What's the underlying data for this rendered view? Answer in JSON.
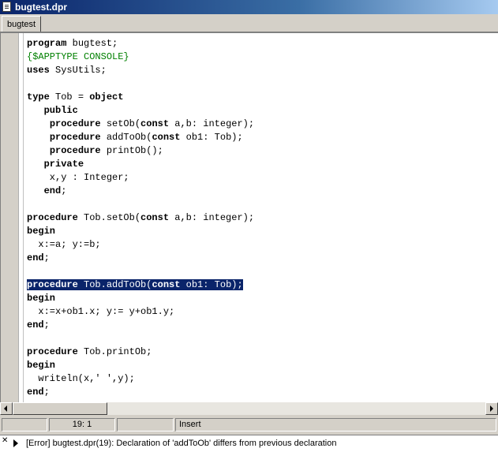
{
  "window": {
    "title": "bugtest.dpr"
  },
  "tabs": [
    {
      "label": "bugtest"
    }
  ],
  "editor": {
    "lines": [
      [
        {
          "t": "program",
          "k": "kw"
        },
        {
          "t": " bugtest;"
        }
      ],
      [
        {
          "t": "{$APPTYPE CONSOLE}",
          "k": "dir"
        }
      ],
      [
        {
          "t": "uses",
          "k": "kw"
        },
        {
          "t": " SysUtils;"
        }
      ],
      [],
      [
        {
          "t": "type",
          "k": "kw"
        },
        {
          "t": " Tob = "
        },
        {
          "t": "object",
          "k": "kw"
        }
      ],
      [
        {
          "t": "   "
        },
        {
          "t": "public",
          "k": "kw"
        }
      ],
      [
        {
          "t": "    "
        },
        {
          "t": "procedure",
          "k": "kw"
        },
        {
          "t": " setOb("
        },
        {
          "t": "const",
          "k": "kw"
        },
        {
          "t": " a,b: integer);"
        }
      ],
      [
        {
          "t": "    "
        },
        {
          "t": "procedure",
          "k": "kw"
        },
        {
          "t": " addToOb("
        },
        {
          "t": "const",
          "k": "kw"
        },
        {
          "t": " ob1: Tob);"
        }
      ],
      [
        {
          "t": "    "
        },
        {
          "t": "procedure",
          "k": "kw"
        },
        {
          "t": " printOb();"
        }
      ],
      [
        {
          "t": "   "
        },
        {
          "t": "private",
          "k": "kw"
        }
      ],
      [
        {
          "t": "    x,y : Integer;"
        }
      ],
      [
        {
          "t": "   "
        },
        {
          "t": "end",
          "k": "kw"
        },
        {
          "t": ";"
        }
      ],
      [],
      [
        {
          "t": "procedure",
          "k": "kw"
        },
        {
          "t": " Tob.setOb("
        },
        {
          "t": "const",
          "k": "kw"
        },
        {
          "t": " a,b: integer);"
        }
      ],
      [
        {
          "t": "begin",
          "k": "kw"
        }
      ],
      [
        {
          "t": "  x:=a; y:=b;"
        }
      ],
      [
        {
          "t": "end",
          "k": "kw"
        },
        {
          "t": ";"
        }
      ],
      [],
      [
        {
          "t": "procedure",
          "k": "kw"
        },
        {
          "t": " Tob.addToOb("
        },
        {
          "t": "const",
          "k": "kw"
        },
        {
          "t": " ob1: Tob);"
        }
      ],
      [
        {
          "t": "begin",
          "k": "kw"
        }
      ],
      [
        {
          "t": "  x:=x+ob1.x; y:= y+ob1.y;"
        }
      ],
      [
        {
          "t": "end",
          "k": "kw"
        },
        {
          "t": ";"
        }
      ],
      [],
      [
        {
          "t": "procedure",
          "k": "kw"
        },
        {
          "t": " Tob.printOb;"
        }
      ],
      [
        {
          "t": "begin",
          "k": "kw"
        }
      ],
      [
        {
          "t": "  writeln(x,' ',y);"
        }
      ],
      [
        {
          "t": "end",
          "k": "kw"
        },
        {
          "t": ";"
        }
      ]
    ],
    "selected_line_index": 18
  },
  "statusbar": {
    "position": "19:   1",
    "mode": "Insert"
  },
  "messages": [
    {
      "text": "[Error] bugtest.dpr(19): Declaration of 'addToOb' differs from previous declaration"
    }
  ],
  "colors": {
    "title_gradient_start": "#0a246a",
    "selection": "#0a246a",
    "directive": "#008000"
  }
}
